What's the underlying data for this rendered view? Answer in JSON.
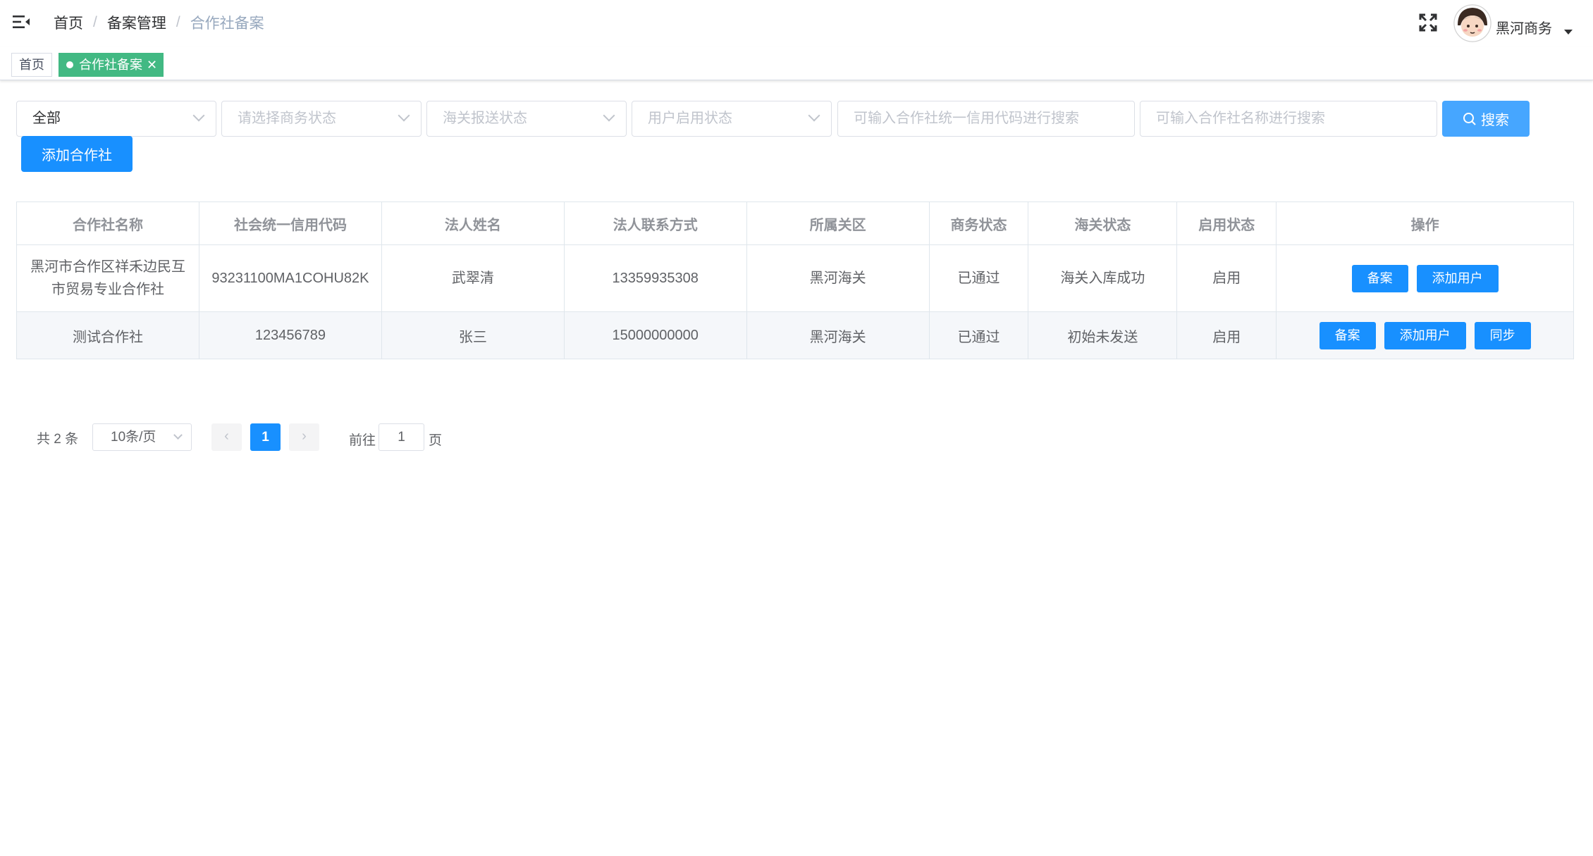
{
  "navbar": {
    "breadcrumb": [
      "首页",
      "备案管理",
      "合作社备案"
    ],
    "separator": "/",
    "username": "黑河商务",
    "icons": [
      "hamburger-icon",
      "fullscreen-icon",
      "avatar",
      "caret-down-icon"
    ]
  },
  "tags": {
    "home": "首页",
    "active": "合作社备案",
    "close": "✕",
    "active_color": "#42b983"
  },
  "filters": {
    "region_value": "全部",
    "business_status_placeholder": "请选择商务状态",
    "customs_status_placeholder": "海关报送状态",
    "user_status_placeholder": "用户启用状态",
    "credit_code_placeholder": "可输入合作社统一信用代码进行搜索",
    "name_placeholder": "可输入合作社名称进行搜索",
    "search_label": "搜索",
    "add_label": "添加合作社",
    "primary_color": "#1890ff"
  },
  "table": {
    "headers": [
      "合作社名称",
      "社会统一信用代码",
      "法人姓名",
      "法人联系方式",
      "所属关区",
      "商务状态",
      "海关状态",
      "启用状态",
      "操作"
    ],
    "rows": [
      {
        "name": "黑河市合作区祥禾边民互市贸易专业合作社",
        "credit_code": "93231100MA1COHU82K",
        "legal_person": "武翠清",
        "phone": "13359935308",
        "district": "黑河海关",
        "business_status": "已通过",
        "customs_status": "海关入库成功",
        "enabled": "启用",
        "actions": [
          "备案",
          "添加用户"
        ]
      },
      {
        "name": "测试合作社",
        "credit_code": "123456789",
        "legal_person": "张三",
        "phone": "15000000000",
        "district": "黑河海关",
        "business_status": "已通过",
        "customs_status": "初始未发送",
        "enabled": "启用",
        "actions": [
          "备案",
          "添加用户",
          "同步"
        ]
      }
    ]
  },
  "pagination": {
    "total": "共 2 条",
    "page_size": "10条/页",
    "prev": "‹",
    "current": "1",
    "next": "›",
    "goto": "前往",
    "jump_value": "1",
    "page_suffix": "页"
  }
}
